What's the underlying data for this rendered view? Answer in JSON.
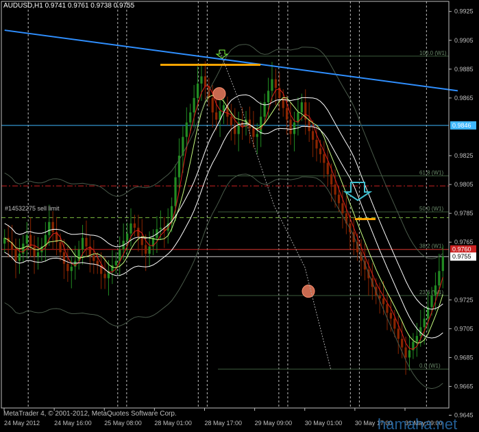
{
  "header": {
    "text": "AUDUSD,H1  0.9741 0.9761 0.9738 0.9755"
  },
  "footer": {
    "copyright": "MetaTrader 4, © 2001-2012, MetaQuotes Software Corp."
  },
  "watermark": {
    "text": "hamaha.net"
  },
  "order_label": {
    "text": "#14532275 sell limit"
  },
  "colors": {
    "background": "#000000",
    "axis": "#c0c0c0",
    "bull_candle": "#228b22",
    "bear_candle": "#8b2500",
    "trend_line": "#2f8fff",
    "horizontal_cyan": "#3fb8ff",
    "red_dashdot": "#cc2222",
    "green_dashed": "#80c040",
    "orange_marker": "#ffa500",
    "fib": "#3c5c3c",
    "price_box": "#ffffff",
    "red_price_box": "#cc2222",
    "cyan_price_box": "#3fb8ff"
  },
  "chart_data": {
    "type": "candlestick",
    "symbol": "AUDUSD",
    "timeframe": "H1",
    "ohlc_last": {
      "open": 0.9741,
      "high": 0.9761,
      "low": 0.9738,
      "close": 0.9755
    },
    "ylim": [
      0.965,
      0.9932
    ],
    "y_ticks": [
      "0.9925",
      "0.9905",
      "0.9885",
      "0.9865",
      "0.9825",
      "0.9805",
      "0.9785",
      "0.9765",
      "0.9725",
      "0.9705",
      "0.9685",
      "0.9665",
      "0.9645"
    ],
    "y_tick_values": [
      0.9925,
      0.9905,
      0.9885,
      0.9865,
      0.9825,
      0.9805,
      0.9785,
      0.9765,
      0.9725,
      0.9705,
      0.9685,
      0.9665,
      0.9645
    ],
    "x_labels": [
      "24 May 2012",
      "24 May 16:00",
      "25 May 08:00",
      "28 May 01:00",
      "28 May 17:00",
      "29 May 09:00",
      "30 May 01:00",
      "30 May 17:00",
      "31 May 09:00"
    ],
    "price_boxes": [
      {
        "value": 0.9846,
        "label": "0.9846",
        "kind": "cyan"
      },
      {
        "value": 0.976,
        "label": "0.9760",
        "kind": "red"
      },
      {
        "value": 0.9755,
        "label": "0.9755",
        "kind": "white"
      }
    ],
    "fibonacci": [
      {
        "level": "100.0",
        "label": "100.0 (W1)",
        "price": 0.9894
      },
      {
        "level": "61.8",
        "label": "61.8 (W1)",
        "price": 0.9811
      },
      {
        "level": "50.0",
        "label": "50.0 (W1)",
        "price": 0.9786
      },
      {
        "level": "38.2",
        "label": "38.2 (W1)",
        "price": 0.976
      },
      {
        "level": "23.6",
        "label": "23.6 (W1)",
        "price": 0.9728
      },
      {
        "level": "0.0",
        "label": "0.0 (W1)",
        "price": 0.9677
      }
    ],
    "horizontal_lines": [
      {
        "name": "cyan-line",
        "price": 0.9846
      },
      {
        "name": "red-dashdot-line",
        "price": 0.9804
      },
      {
        "name": "green-dashed-line",
        "price": 0.9782
      },
      {
        "name": "red-solid-line",
        "price": 0.976
      },
      {
        "name": "white-price-line",
        "price": 0.9755
      }
    ],
    "trend_line": {
      "from": {
        "bar": 0,
        "price": 0.9912
      },
      "to": {
        "bar": 122,
        "price": 0.987
      }
    },
    "series_close": [
      0.9768,
      0.9765,
      0.976,
      0.9752,
      0.9757,
      0.9764,
      0.977,
      0.9762,
      0.9755,
      0.9758,
      0.9762,
      0.977,
      0.9779,
      0.9772,
      0.9765,
      0.9758,
      0.975,
      0.9745,
      0.9748,
      0.9752,
      0.976,
      0.9768,
      0.9762,
      0.9756,
      0.9752,
      0.9749,
      0.9743,
      0.974,
      0.9745,
      0.9749,
      0.9752,
      0.976,
      0.9766,
      0.9771,
      0.9778,
      0.9775,
      0.9769,
      0.9763,
      0.9757,
      0.9762,
      0.9768,
      0.9774,
      0.9775,
      0.9773,
      0.9778,
      0.979,
      0.981,
      0.9825,
      0.9838,
      0.9848,
      0.9855,
      0.9865,
      0.9875,
      0.988,
      0.9873,
      0.9865,
      0.9855,
      0.985,
      0.9856,
      0.986,
      0.9852,
      0.9846,
      0.984,
      0.9848,
      0.9845,
      0.985,
      0.9844,
      0.9838,
      0.984,
      0.9852,
      0.9862,
      0.987,
      0.9878,
      0.9872,
      0.9865,
      0.9858,
      0.985,
      0.984,
      0.9848,
      0.9855,
      0.9862,
      0.985,
      0.9842,
      0.9836,
      0.983,
      0.9826,
      0.982,
      0.9812,
      0.9805,
      0.9798,
      0.9792,
      0.9785,
      0.9778,
      0.9772,
      0.9765,
      0.9758,
      0.9752,
      0.9746,
      0.974,
      0.9734,
      0.9728,
      0.9726,
      0.9722,
      0.9716,
      0.9712,
      0.9705,
      0.9698,
      0.9692,
      0.9685,
      0.969,
      0.9696,
      0.97,
      0.9706,
      0.9712,
      0.972,
      0.9728,
      0.9735,
      0.9745,
      0.9755
    ]
  }
}
